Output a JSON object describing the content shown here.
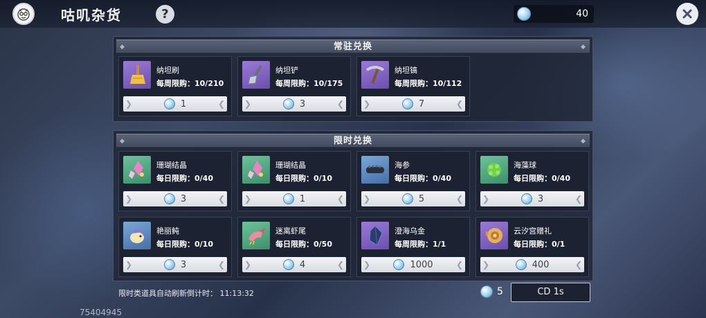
{
  "header": {
    "title": "咕叽杂货",
    "help_symbol": "?",
    "currency_amount": "40",
    "close_icon": "close-icon"
  },
  "regular_section": {
    "title": "常驻兑换",
    "items": [
      {
        "name": "纳坦刷",
        "limit": "每周限购：10/210",
        "price": "1",
        "icon": "brush-icon"
      },
      {
        "name": "纳坦铲",
        "limit": "每周限购：10/175",
        "price": "3",
        "icon": "shovel-icon"
      },
      {
        "name": "纳坦镐",
        "limit": "每周限购：10/112",
        "price": "7",
        "icon": "pickaxe-icon"
      }
    ]
  },
  "limited_section": {
    "title": "限时兑换",
    "items": [
      {
        "name": "珊瑚结晶",
        "limit": "每日限购：0/40",
        "price": "3",
        "icon": "coral-crystal-icon"
      },
      {
        "name": "珊瑚结晶",
        "limit": "每日限购：0/10",
        "price": "1",
        "icon": "coral-crystal-icon"
      },
      {
        "name": "海参",
        "limit": "每日限购：0/40",
        "price": "5",
        "icon": "sea-cucumber-icon"
      },
      {
        "name": "海藻球",
        "limit": "每日限购：0/40",
        "price": "3",
        "icon": "seaweed-ball-icon"
      },
      {
        "name": "艳丽鲀",
        "limit": "每日限购：0/10",
        "price": "3",
        "icon": "pufferfish-icon"
      },
      {
        "name": "迷离虾尾",
        "limit": "每日限购：0/50",
        "price": "4",
        "icon": "shrimp-tail-icon"
      },
      {
        "name": "澄海乌金",
        "limit": "每周限购：1/1",
        "price": "1000",
        "icon": "black-crystal-icon"
      },
      {
        "name": "云汐宫赠礼",
        "limit": "每日限购：0/1",
        "price": "400",
        "icon": "gift-shell-icon"
      }
    ]
  },
  "footer": {
    "refresh_text": "限时类道具自动刷新倒计时：  11:13:32",
    "refresh_cost": "5",
    "cd_button": "CD 1s",
    "uid": "75404945"
  },
  "colors": {
    "panel_bg": "#1e2434",
    "price_bg": "#e6e8ec",
    "thumb_purple": "#8262c4",
    "thumb_green": "#52a883",
    "thumb_blue": "#5f8ac0"
  }
}
